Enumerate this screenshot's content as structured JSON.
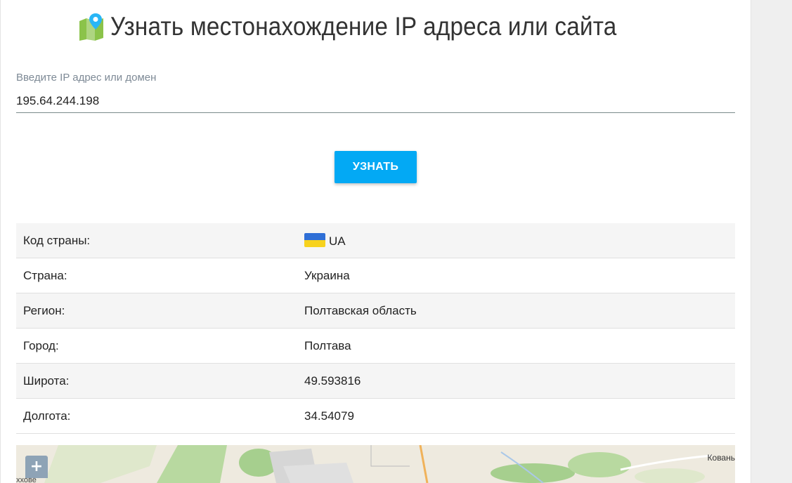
{
  "header": {
    "title": "Узнать местонахождение IP адреса или сайта",
    "icon": "map-pin-icon"
  },
  "form": {
    "input_label": "Введите IP адрес или домен",
    "input_value": "195.64.244.198",
    "submit_label": "УЗНАТЬ"
  },
  "results": [
    {
      "label": "Код страны:",
      "value": "UA",
      "flag": "ua-flag-icon"
    },
    {
      "label": "Страна:",
      "value": "Украина"
    },
    {
      "label": "Регион:",
      "value": "Полтавская область"
    },
    {
      "label": "Город:",
      "value": "Полтава"
    },
    {
      "label": "Широта:",
      "value": "49.593816"
    },
    {
      "label": "Долгота:",
      "value": "34.54079"
    }
  ],
  "map": {
    "zoom_in_label": "+",
    "place_right": "Ковань",
    "place_left": "ххове"
  },
  "colors": {
    "accent": "#03a9f4",
    "row_alt": "#f5f5f5",
    "flag_blue": "#2f6fd6",
    "flag_yellow": "#f7d21e"
  }
}
